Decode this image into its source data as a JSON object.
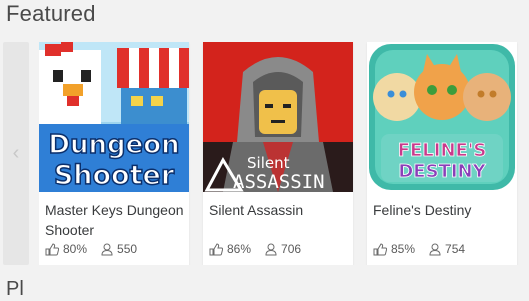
{
  "section": {
    "title": "Featured",
    "next_title": "Pl"
  },
  "nav": {
    "prev_glyph": "‹"
  },
  "games": [
    {
      "thumb_text_1": "Dungeon",
      "thumb_text_2": "Shooter",
      "name": "Master Keys Dungeon Shooter",
      "rating": "80%",
      "players": "550"
    },
    {
      "thumb_text_1": "Silent",
      "thumb_text_2": "ASSASSIN",
      "name": "Silent Assassin",
      "rating": "86%",
      "players": "706"
    },
    {
      "thumb_text_1": "FELINE'S",
      "thumb_text_2": "DESTINY",
      "name": "Feline's Destiny",
      "rating": "85%",
      "players": "754"
    }
  ],
  "colors": {
    "background": "#f2f2f2",
    "card": "#ffffff",
    "text": "#393b3d",
    "accent_red": "#d3231c",
    "accent_pink": "#c93a8c"
  }
}
